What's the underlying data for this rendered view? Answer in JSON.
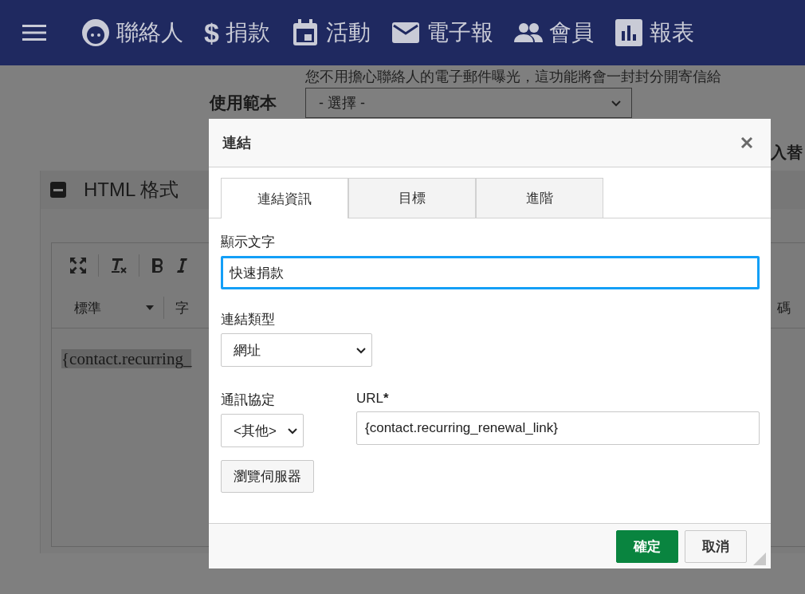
{
  "nav": {
    "items": [
      {
        "label": "聯絡人"
      },
      {
        "glyph": "$",
        "label": "捐款"
      },
      {
        "label": "活動"
      },
      {
        "label": "電子報"
      },
      {
        "label": "會員"
      },
      {
        "label": "報表"
      }
    ]
  },
  "page": {
    "hint": "您不用擔心聯絡人的電子郵件曝光，這功能將會一封封分開寄信給",
    "template": {
      "label": "使用範本",
      "value": "- 選擇 -"
    },
    "side_label": "入替",
    "section": {
      "title": "HTML 格式",
      "expanded": true
    },
    "editor": {
      "format": "標準",
      "font": "字",
      "right_label": "碼",
      "content": "{contact.recurring_",
      "content_selected": true
    }
  },
  "dialog": {
    "title": "連結",
    "tabs": [
      {
        "label": "連結資訊",
        "selected": true
      },
      {
        "label": "目標",
        "selected": false
      },
      {
        "label": "進階",
        "selected": false
      }
    ],
    "display_text": {
      "label": "顯示文字",
      "value": "快速捐款",
      "focused": true
    },
    "link_type": {
      "label": "連結類型",
      "value": "網址"
    },
    "protocol": {
      "label": "通訊協定",
      "value": "<其他>"
    },
    "url": {
      "label": "URL",
      "required": true,
      "required_mark": "*",
      "value": "{contact.recurring_renewal_link}"
    },
    "browse_button": "瀏覽伺服器",
    "buttons": [
      {
        "kind": "primary",
        "label": "確定"
      },
      {
        "kind": "default",
        "label": "取消"
      }
    ]
  }
}
